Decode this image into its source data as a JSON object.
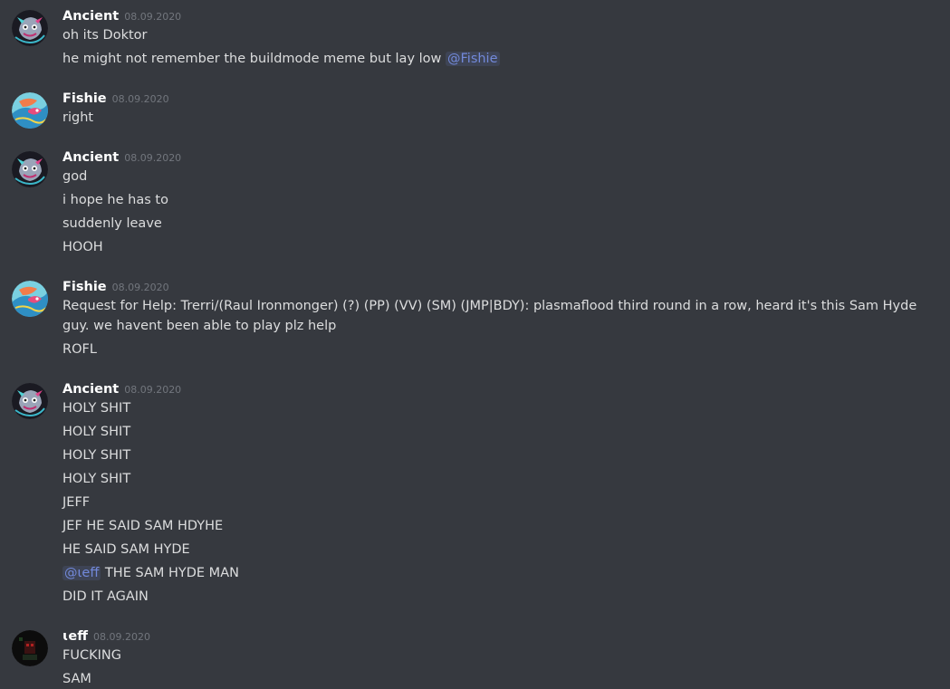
{
  "colors": {
    "background": "#36393f",
    "text": "#dcddde",
    "username": "#ffffff",
    "timestamp": "#72767d",
    "mention": "#7289da"
  },
  "messages": [
    {
      "author": "Ancient",
      "avatar_icon": "ancient-avatar-icon",
      "time": "08.09.2020",
      "lines": [
        {
          "text": "oh its Doktor"
        },
        {
          "text": "he might not remember the buildmode meme but lay low ",
          "mention": "@Fishie"
        }
      ]
    },
    {
      "author": "Fishie",
      "avatar_icon": "fishie-avatar-icon",
      "time": "08.09.2020",
      "lines": [
        {
          "text": "right"
        }
      ]
    },
    {
      "author": "Ancient",
      "avatar_icon": "ancient-avatar-icon",
      "time": "08.09.2020",
      "lines": [
        {
          "text": "god"
        },
        {
          "text": "i hope he has to"
        },
        {
          "text": "suddenly leave"
        },
        {
          "text": "HOOH"
        }
      ]
    },
    {
      "author": "Fishie",
      "avatar_icon": "fishie-avatar-icon",
      "time": "08.09.2020",
      "lines": [
        {
          "text": "Request for Help: Trerri/(Raul Ironmonger) (?) (PP) (VV) (SM) (JMP|BDY): plasmaflood third round in a row, heard it's this Sam Hyde guy. we havent been able to play plz help"
        },
        {
          "text": "ROFL"
        }
      ]
    },
    {
      "author": "Ancient",
      "avatar_icon": "ancient-avatar-icon",
      "time": "08.09.2020",
      "lines": [
        {
          "text": "HOLY SHIT"
        },
        {
          "text": "HOLY SHIT"
        },
        {
          "text": "HOLY SHIT"
        },
        {
          "text": "HOLY SHIT"
        },
        {
          "text": "JEFF"
        },
        {
          "text": "JEF HE SAID SAM HDYHE"
        },
        {
          "text": "HE SAID SAM HYDE"
        },
        {
          "mention": "@ɩeff",
          "text": " THE SAM HYDE MAN"
        },
        {
          "text": "DID IT AGAIN"
        }
      ]
    },
    {
      "author": "ɩeff",
      "avatar_icon": "jeff-avatar-icon",
      "time": "08.09.2020",
      "lines": [
        {
          "text": "FUCKING"
        },
        {
          "text": "SAM"
        }
      ]
    }
  ]
}
